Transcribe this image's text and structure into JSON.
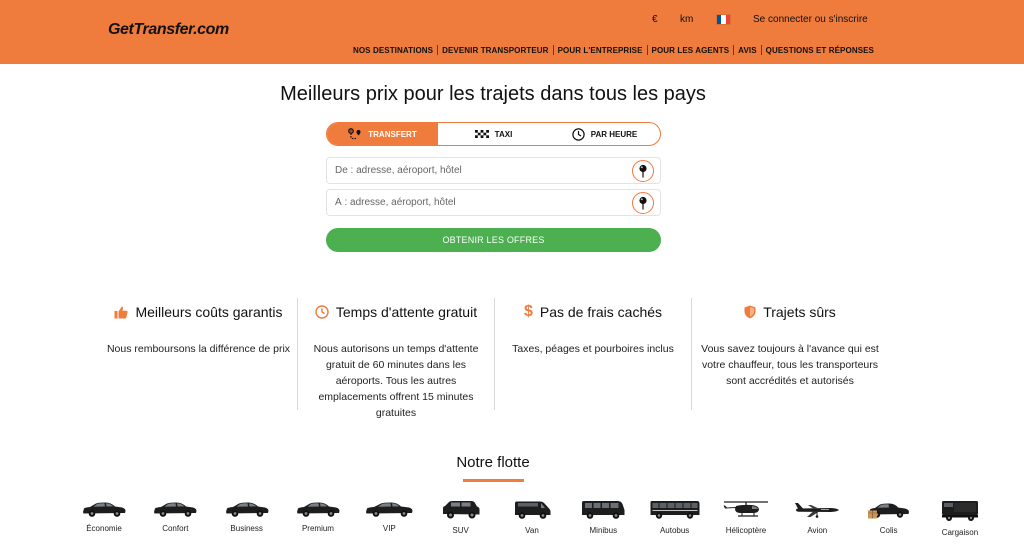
{
  "header": {
    "logo": "GetTransfer.com",
    "currency": "€",
    "units": "km",
    "flag_colors": [
      "#0055a4",
      "#ffffff",
      "#ef4135"
    ],
    "login": "Se connecter ou s'inscrire",
    "nav": [
      "NOS DESTINATIONS",
      "DEVENIR TRANSPORTEUR",
      "POUR L'ENTREPRISE",
      "POUR LES AGENTS",
      "AVIS",
      "QUESTIONS ET RÉPONSES"
    ]
  },
  "hero": {
    "title": "Meilleurs prix pour les trajets dans tous les pays",
    "modes": [
      {
        "label": "TRANSFERT",
        "icon": "route-icon",
        "active": true
      },
      {
        "label": "TAXI",
        "icon": "taxi-checker-icon",
        "active": false
      },
      {
        "label": "PAR HEURE",
        "icon": "clock-icon",
        "active": false
      }
    ],
    "from_placeholder": "De : adresse, aéroport, hôtel",
    "to_placeholder": "À : adresse, aéroport, hôtel",
    "cta": "OBTENIR LES OFFRES"
  },
  "features": [
    {
      "icon": "thumbs-up-icon",
      "title": "Meilleurs coûts garantis",
      "text": "Nous remboursons la différence de prix"
    },
    {
      "icon": "clock-icon",
      "title": "Temps d'attente gratuit",
      "text": "Nous autorisons un temps d'attente gratuit de 60 minutes dans les aéroports. Tous les autres emplacements offrent 15 minutes gratuites"
    },
    {
      "icon": "dollar-icon",
      "title": "Pas de frais cachés",
      "text": "Taxes, péages et pourboires inclus"
    },
    {
      "icon": "shield-icon",
      "title": "Trajets sûrs",
      "text": "Vous savez toujours à l'avance qui est votre chauffeur, tous les transporteurs sont accrédités et autorisés"
    }
  ],
  "fleet": {
    "title": "Notre flotte",
    "vehicles": [
      {
        "label": "Économie",
        "kind": "sedan"
      },
      {
        "label": "Confort",
        "kind": "sedan"
      },
      {
        "label": "Business",
        "kind": "sedan"
      },
      {
        "label": "Premium",
        "kind": "sedan"
      },
      {
        "label": "VIP",
        "kind": "sedan"
      },
      {
        "label": "SUV",
        "kind": "suv"
      },
      {
        "label": "Van",
        "kind": "van"
      },
      {
        "label": "Minibus",
        "kind": "minibus"
      },
      {
        "label": "Autobus",
        "kind": "bus"
      },
      {
        "label": "Hélicoptère",
        "kind": "helicopter"
      },
      {
        "label": "Avion",
        "kind": "plane"
      },
      {
        "label": "Colis",
        "kind": "parcel"
      },
      {
        "label": "Cargaison",
        "kind": "truck"
      }
    ]
  },
  "colors": {
    "accent": "#ef7b3c",
    "cta": "#4caf50"
  }
}
